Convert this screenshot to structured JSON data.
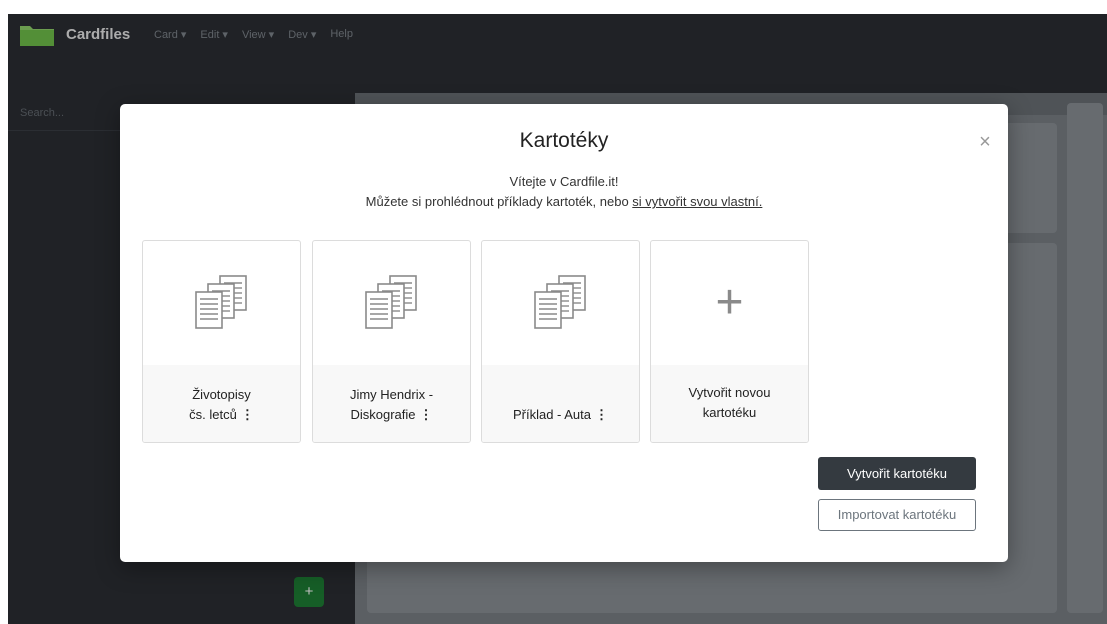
{
  "app": {
    "brand": "Cardfiles",
    "menu": [
      "Card ▾",
      "Edit ▾",
      "View ▾",
      "Dev ▾",
      "Help"
    ],
    "search_placeholder": "Search...",
    "sidebar_add": "+"
  },
  "modal": {
    "title": "Kartotéky",
    "close": "×",
    "welcome_line1": "Vítejte v Cardfile.it!",
    "welcome_line2_prefix": "Můžete si prohlédnout příklady kartoték, nebo ",
    "welcome_line2_link": "si vytvořit svou vlastní.",
    "cards": [
      {
        "line1": "Životopisy",
        "line2": "čs. letců",
        "menu": "⋮",
        "icon": "document-stack-icon"
      },
      {
        "line1": "Jimy Hendrix -",
        "line2": "Diskografie",
        "menu": "⋮",
        "icon": "document-stack-icon"
      },
      {
        "line1": "Příklad - Auta",
        "menu": "⋮",
        "icon": "document-stack-icon"
      },
      {
        "line1": "Vytvořit novou",
        "line2": "kartotéku",
        "icon": "plus-icon",
        "symbol": "+"
      }
    ],
    "create_button": "Vytvořit kartotéku",
    "import_button": "Importovat kartotéku"
  },
  "colors": {
    "topbar": "#2b2e33",
    "primary_button": "#343a40",
    "add_button": "#1e7e34"
  }
}
